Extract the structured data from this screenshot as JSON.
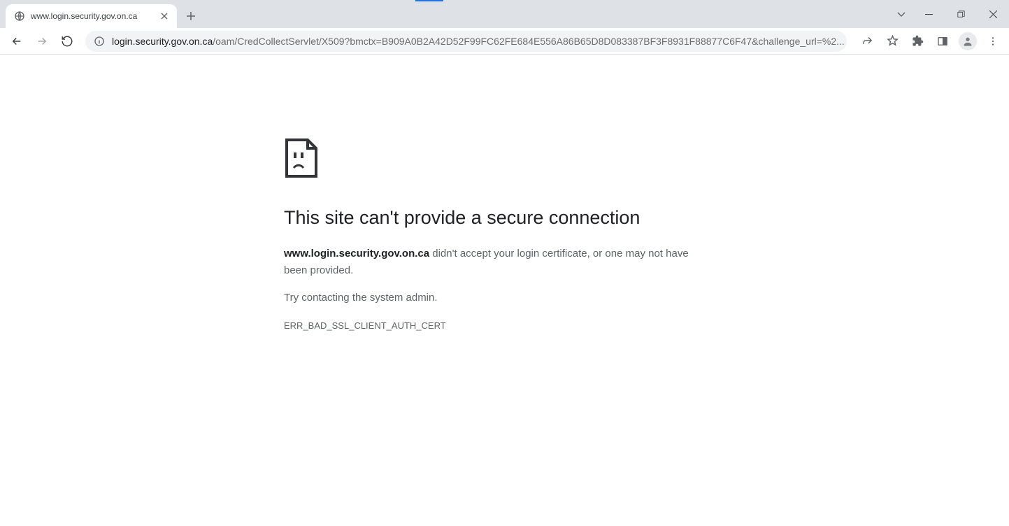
{
  "tab": {
    "title": "www.login.security.gov.on.ca"
  },
  "url": {
    "host": "login.security.gov.on.ca",
    "path": "/oam/CredCollectServlet/X509?bmctx=B909A0B2A42D52F99FC62FE684E556A86B65D8D083387BF3F8931F88877C6F47&challenge_url=%2..."
  },
  "error": {
    "title": "This site can't provide a secure connection",
    "host": "www.login.security.gov.on.ca",
    "message_after_host": " didn't accept your login certificate, or one may not have been provided.",
    "suggestion": "Try contacting the system admin.",
    "code": "ERR_BAD_SSL_CLIENT_AUTH_CERT"
  }
}
